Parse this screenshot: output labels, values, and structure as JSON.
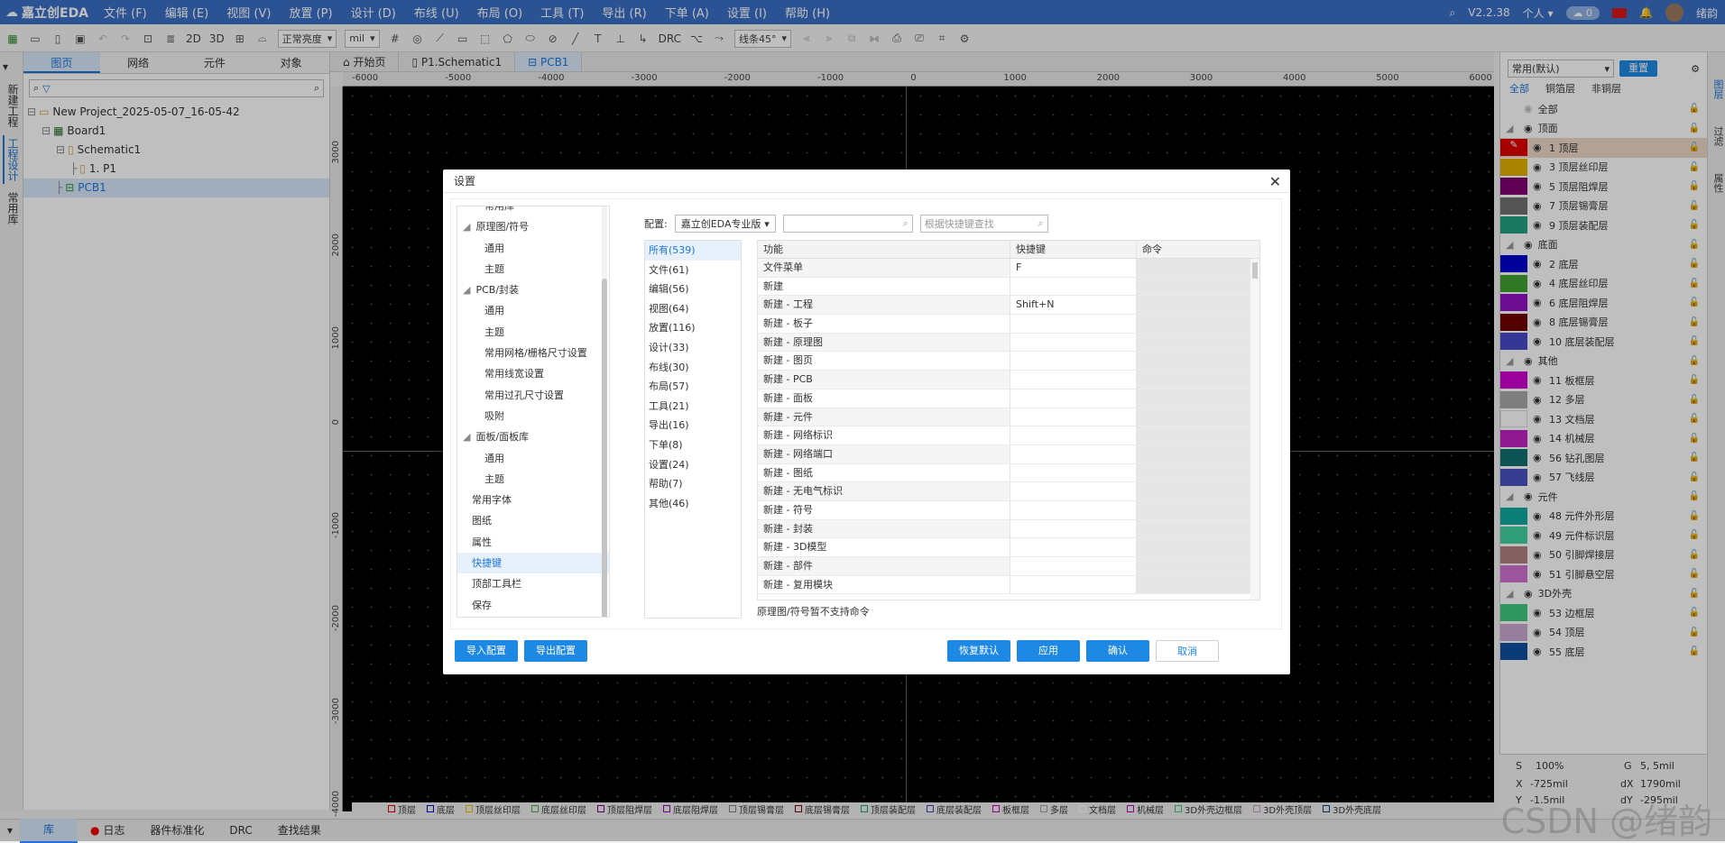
{
  "app": {
    "logo": "嘉立创EDA",
    "menus": [
      "文件 (F)",
      "编辑 (E)",
      "视图 (V)",
      "放置 (P)",
      "设计 (D)",
      "布线 (U)",
      "布局 (O)",
      "工具 (T)",
      "导出 (R)",
      "下单 (A)",
      "设置 (I)",
      "帮助 (H)"
    ],
    "version": "V2.2.38",
    "account": "个人",
    "cloud_count": "0",
    "username": "绪韵"
  },
  "toolbar": {
    "view2d": "2D",
    "view3d": "3D",
    "brightness": "正常亮度",
    "unit": "mil",
    "drc": "DRC",
    "line_angle": "线条45°"
  },
  "left_strip": [
    "新建工程",
    "工程设计",
    "常用库"
  ],
  "left_panel": {
    "tabs": [
      "图页",
      "网络",
      "元件",
      "对象"
    ],
    "tree": [
      {
        "label": "New Project_2025-05-07_16-05-42",
        "indent": 0
      },
      {
        "label": "Board1",
        "indent": 1
      },
      {
        "label": "Schematic1",
        "indent": 2
      },
      {
        "label": "1. P1",
        "indent": 3
      },
      {
        "label": "PCB1",
        "indent": 2
      }
    ]
  },
  "doc_tabs": [
    "开始页",
    "P1.Schematic1",
    "PCB1"
  ],
  "ruler": {
    "top": [
      "-6000",
      "-5000",
      "-4000",
      "-3000",
      "-2000",
      "-1000",
      "0",
      "1000",
      "2000",
      "3000",
      "4000",
      "5000",
      "6000"
    ],
    "left": [
      "3000",
      "2000",
      "1000",
      "0",
      "-1000",
      "-2000",
      "-3000",
      "-4000"
    ]
  },
  "layer_bar": [
    {
      "name": "顶层",
      "color": "#e00000"
    },
    {
      "name": "底层",
      "color": "#0000e0"
    },
    {
      "name": "顶层丝印层",
      "color": "#e0c000"
    },
    {
      "name": "底层丝印层",
      "color": "#40b040"
    },
    {
      "name": "顶层阻焊层",
      "color": "#800080"
    },
    {
      "name": "底层阻焊层",
      "color": "#a000c0"
    },
    {
      "name": "顶层锡膏层",
      "color": "#808080"
    },
    {
      "name": "底层锡膏层",
      "color": "#800000"
    },
    {
      "name": "顶层装配层",
      "color": "#20a080"
    },
    {
      "name": "底层装配层",
      "color": "#4040c0"
    },
    {
      "name": "板框层",
      "color": "#c000c0"
    },
    {
      "name": "多层",
      "color": "#a0a0a0"
    },
    {
      "name": "文档层",
      "color": "#ffffff"
    },
    {
      "name": "机械层",
      "color": "#c000c0"
    },
    {
      "name": "3D外壳边框层",
      "color": "#40c080"
    },
    {
      "name": "3D外壳顶层",
      "color": "#c0a0c0"
    },
    {
      "name": "3D外壳底层",
      "color": "#104080"
    }
  ],
  "right_panel": {
    "preset": "常用(默认)",
    "reset": "重置",
    "filter_tabs": [
      "全部",
      "铜箔层",
      "非铜层"
    ],
    "rows": [
      {
        "type": "group",
        "label": "全部"
      },
      {
        "type": "group",
        "label": "顶面"
      },
      {
        "type": "layer",
        "label": "1 顶层",
        "color": "#e00000",
        "active": true
      },
      {
        "type": "layer",
        "label": "3 顶层丝印层",
        "color": "#e0b000"
      },
      {
        "type": "layer",
        "label": "5 顶层阻焊层",
        "color": "#800070"
      },
      {
        "type": "layer",
        "label": "7 顶层锡膏层",
        "color": "#707070"
      },
      {
        "type": "layer",
        "label": "9 顶层装配层",
        "color": "#20a080"
      },
      {
        "type": "group",
        "label": "底面"
      },
      {
        "type": "layer",
        "label": "2 底层",
        "color": "#0000d0"
      },
      {
        "type": "layer",
        "label": "4 底层丝印层",
        "color": "#40a030"
      },
      {
        "type": "layer",
        "label": "6 底层阻焊层",
        "color": "#9010c0"
      },
      {
        "type": "layer",
        "label": "8 底层锡膏层",
        "color": "#700000"
      },
      {
        "type": "layer",
        "label": "10 底层装配层",
        "color": "#4848c8"
      },
      {
        "type": "group",
        "label": "其他"
      },
      {
        "type": "layer",
        "label": "11 板框层",
        "color": "#d000d0"
      },
      {
        "type": "layer",
        "label": "12 多层",
        "color": "#a8a8a8"
      },
      {
        "type": "layer",
        "label": "13 文档层",
        "color": "#ffffff"
      },
      {
        "type": "layer",
        "label": "14 机械层",
        "color": "#c020c0"
      },
      {
        "type": "layer",
        "label": "56 钻孔图层",
        "color": "#107070"
      },
      {
        "type": "layer",
        "label": "57 飞线层",
        "color": "#4850c0"
      },
      {
        "type": "group",
        "label": "元件"
      },
      {
        "type": "layer",
        "label": "48 元件外形层",
        "color": "#10a8a0"
      },
      {
        "type": "layer",
        "label": "49 元件标识层",
        "color": "#40d0a0"
      },
      {
        "type": "layer",
        "label": "50 引脚焊接层",
        "color": "#b08080"
      },
      {
        "type": "layer",
        "label": "51 引脚悬空层",
        "color": "#d070d0"
      },
      {
        "type": "group",
        "label": "3D外壳"
      },
      {
        "type": "layer",
        "label": "53 边框层",
        "color": "#40c880"
      },
      {
        "type": "layer",
        "label": "54 顶层",
        "color": "#c8a8d0"
      },
      {
        "type": "layer",
        "label": "55 底层",
        "color": "#1050a0"
      }
    ],
    "right_tabs": [
      "图层",
      "过滤",
      "属性"
    ]
  },
  "status": {
    "s_label": "S",
    "s_value": "100%",
    "g_label": "G",
    "g_value": "5, 5mil",
    "x_label": "X",
    "x_value": "-725mil",
    "dx_label": "dX",
    "dx_value": "1790mil",
    "y_label": "Y",
    "y_value": "-1.5mil",
    "dy_label": "dY",
    "dy_value": "-295mil"
  },
  "bottom_tabs": [
    "库",
    "日志",
    "器件标准化",
    "DRC",
    "查找结果"
  ],
  "watermark": "CSDN @绪韵",
  "dialog": {
    "title": "设置",
    "nav": [
      {
        "label": "常用库",
        "level": 1
      },
      {
        "label": "原理图/符号",
        "level": 0
      },
      {
        "label": "通用",
        "level": 1
      },
      {
        "label": "主题",
        "level": 1
      },
      {
        "label": "PCB/封装",
        "level": 0
      },
      {
        "label": "通用",
        "level": 1
      },
      {
        "label": "主题",
        "level": 1
      },
      {
        "label": "常用网格/栅格尺寸设置",
        "level": 1
      },
      {
        "label": "常用线宽设置",
        "level": 1
      },
      {
        "label": "常用过孔尺寸设置",
        "level": 1
      },
      {
        "label": "吸附",
        "level": 1
      },
      {
        "label": "面板/面板库",
        "level": 0
      },
      {
        "label": "通用",
        "level": 1
      },
      {
        "label": "主题",
        "level": 1
      },
      {
        "label": "常用字体",
        "level": 2
      },
      {
        "label": "图纸",
        "level": 2
      },
      {
        "label": "属性",
        "level": 2
      },
      {
        "label": "快捷键",
        "level": 2,
        "active": true
      },
      {
        "label": "顶部工具栏",
        "level": 2
      },
      {
        "label": "保存",
        "level": 2
      }
    ],
    "config_label": "配置:",
    "config_value": "嘉立创EDA专业版",
    "shortcut_search_placeholder": "根据快捷键查找",
    "categories": [
      "所有(539)",
      "文件(61)",
      "编辑(56)",
      "视图(64)",
      "放置(116)",
      "设计(33)",
      "布线(30)",
      "布局(57)",
      "工具(21)",
      "导出(16)",
      "下单(8)",
      "设置(24)",
      "帮助(7)",
      "其他(46)"
    ],
    "table_headers": [
      "功能",
      "快捷键",
      "命令"
    ],
    "rows": [
      [
        "文件菜单",
        "F"
      ],
      [
        "新建",
        ""
      ],
      [
        "新建 - 工程",
        "Shift+N"
      ],
      [
        "新建 - 板子",
        ""
      ],
      [
        "新建 - 原理图",
        ""
      ],
      [
        "新建 - 图页",
        ""
      ],
      [
        "新建 - PCB",
        ""
      ],
      [
        "新建 - 面板",
        ""
      ],
      [
        "新建 - 元件",
        ""
      ],
      [
        "新建 - 网络标识",
        ""
      ],
      [
        "新建 - 网络端口",
        ""
      ],
      [
        "新建 - 图纸",
        ""
      ],
      [
        "新建 - 无电气标识",
        ""
      ],
      [
        "新建 - 符号",
        ""
      ],
      [
        "新建 - 封装",
        ""
      ],
      [
        "新建 - 3D模型",
        ""
      ],
      [
        "新建 - 部件",
        ""
      ],
      [
        "新建 - 复用模块",
        ""
      ]
    ],
    "note": "原理图/符号暂不支持命令",
    "buttons": {
      "import": "导入配置",
      "export": "导出配置",
      "restore": "恢复默认",
      "apply": "应用",
      "confirm": "确认",
      "cancel": "取消"
    }
  }
}
